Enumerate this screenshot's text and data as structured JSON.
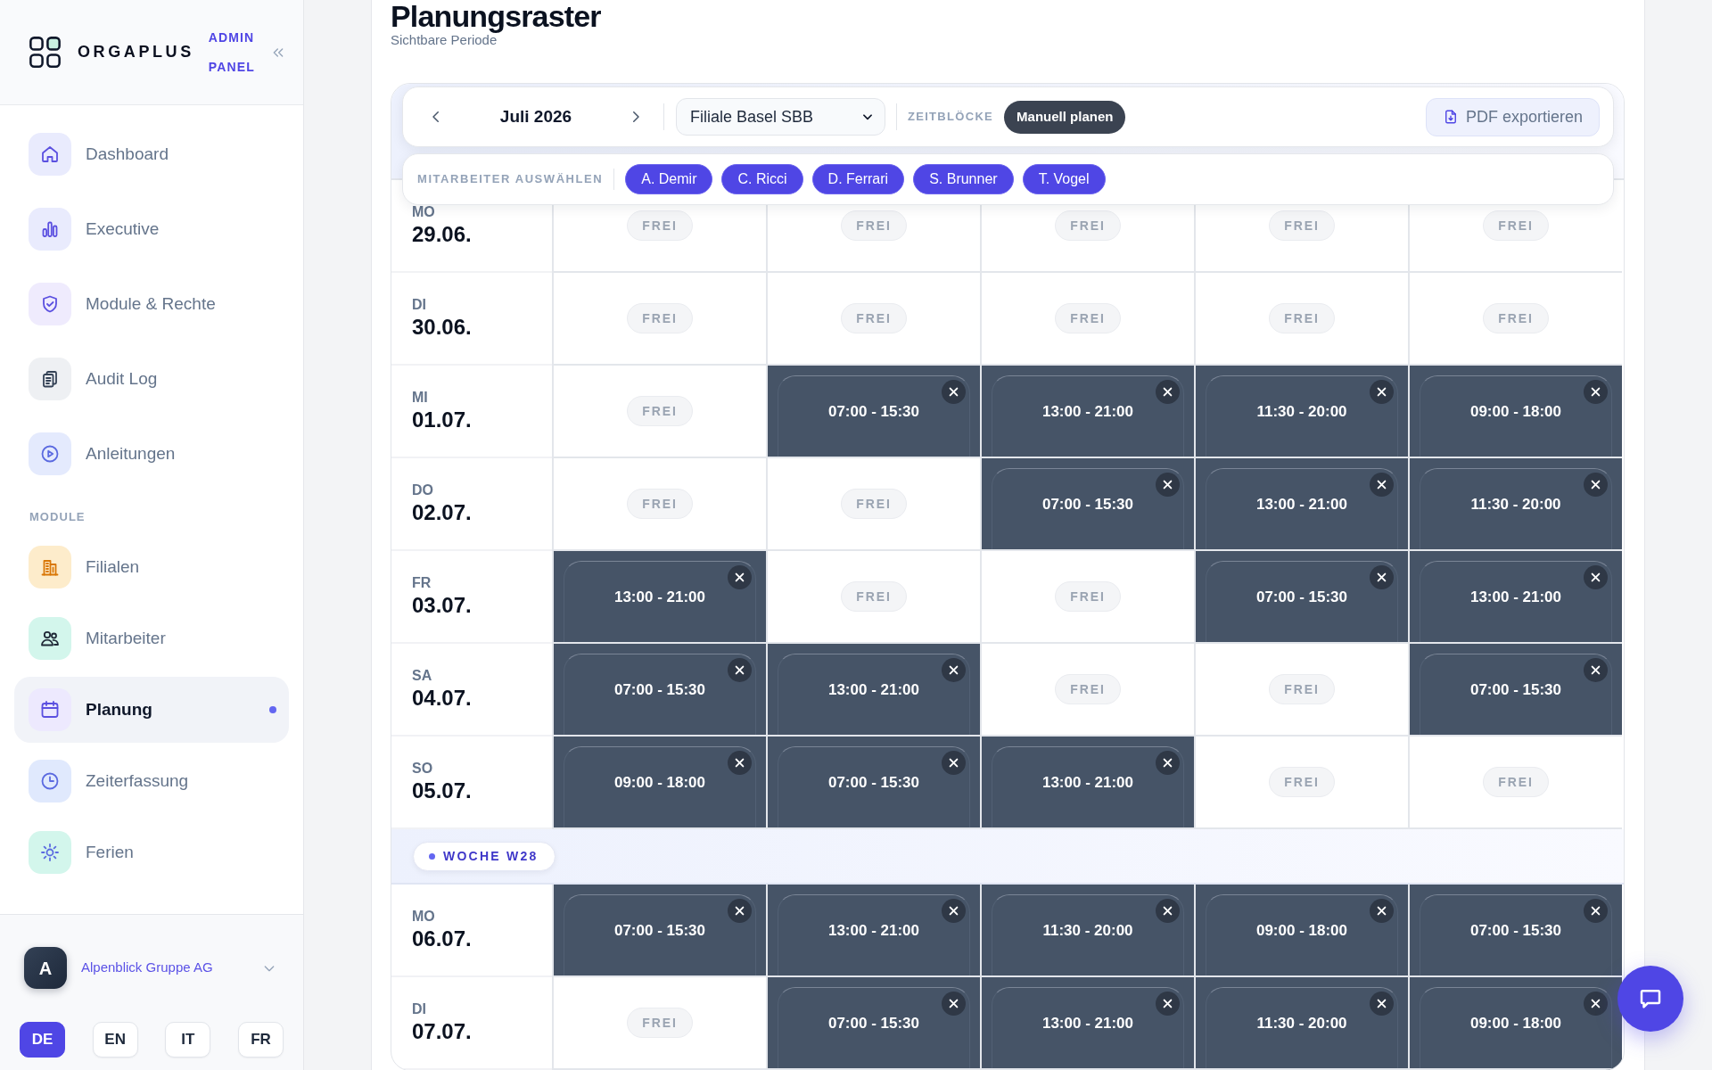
{
  "sidebar": {
    "brand": {
      "name": "ORGAPLUS",
      "subtitle": "ADMIN PANEL"
    },
    "items": [
      {
        "label": "Dashboard",
        "selected": false
      },
      {
        "label": "Executive",
        "selected": false
      },
      {
        "label": "Module & Rechte",
        "selected": false
      },
      {
        "label": "Audit Log",
        "selected": false
      },
      {
        "label": "Anleitungen",
        "selected": false
      }
    ],
    "section_label": "MODULE",
    "module_items": [
      {
        "label": "Filialen",
        "selected": false
      },
      {
        "label": "Mitarbeiter",
        "selected": false
      },
      {
        "label": "Planung",
        "selected": true
      },
      {
        "label": "Zeiterfassung",
        "selected": false
      },
      {
        "label": "Ferien",
        "selected": false
      }
    ],
    "organization": {
      "initial": "A",
      "name": "Alpenblick Gruppe AG"
    },
    "languages": [
      {
        "label": "DE",
        "selected": true
      },
      {
        "label": "EN",
        "selected": false
      },
      {
        "label": "IT",
        "selected": false
      },
      {
        "label": "FR",
        "selected": false
      }
    ]
  },
  "page": {
    "title": "Planungsraster",
    "subtitle": "Sichtbare Periode"
  },
  "toolbar": {
    "month": "Juli 2026",
    "branch": "Filiale Basel SBB",
    "blocks_label": "ZEITBLÖCKE",
    "mode_button": "Manuell planen",
    "export_button": "PDF exportieren"
  },
  "employee_picker": {
    "label": "MITARBEITER AUSWÄHLEN",
    "employees": [
      {
        "name": "A. Demir",
        "selected": true
      },
      {
        "name": "C. Ricci",
        "selected": true
      },
      {
        "name": "D. Ferrari",
        "selected": true
      },
      {
        "name": "S. Brunner",
        "selected": true
      },
      {
        "name": "T. Vogel",
        "selected": true
      }
    ]
  },
  "schedule": {
    "rows": [
      {
        "kind": "day",
        "weekday": "MO",
        "date": "29.06.",
        "cells": [
          {
            "kind": "free",
            "label": "FREI"
          },
          {
            "kind": "free",
            "label": "FREI"
          },
          {
            "kind": "free",
            "label": "FREI"
          },
          {
            "kind": "free",
            "label": "FREI"
          },
          {
            "kind": "free",
            "label": "FREI"
          }
        ]
      },
      {
        "kind": "day",
        "weekday": "DI",
        "date": "30.06.",
        "cells": [
          {
            "kind": "free",
            "label": "FREI"
          },
          {
            "kind": "free",
            "label": "FREI"
          },
          {
            "kind": "free",
            "label": "FREI"
          },
          {
            "kind": "free",
            "label": "FREI"
          },
          {
            "kind": "free",
            "label": "FREI"
          }
        ]
      },
      {
        "kind": "day",
        "weekday": "MI",
        "date": "01.07.",
        "cells": [
          {
            "kind": "free",
            "label": "FREI"
          },
          {
            "kind": "shift",
            "time": "07:00 - 15:30"
          },
          {
            "kind": "shift",
            "time": "13:00 - 21:00"
          },
          {
            "kind": "shift",
            "time": "11:30 - 20:00"
          },
          {
            "kind": "shift",
            "time": "09:00 - 18:00"
          }
        ]
      },
      {
        "kind": "day",
        "weekday": "DO",
        "date": "02.07.",
        "cells": [
          {
            "kind": "free",
            "label": "FREI"
          },
          {
            "kind": "free",
            "label": "FREI"
          },
          {
            "kind": "shift",
            "time": "07:00 - 15:30"
          },
          {
            "kind": "shift",
            "time": "13:00 - 21:00"
          },
          {
            "kind": "shift",
            "time": "11:30 - 20:00"
          }
        ]
      },
      {
        "kind": "day",
        "weekday": "FR",
        "date": "03.07.",
        "cells": [
          {
            "kind": "shift",
            "time": "13:00 - 21:00"
          },
          {
            "kind": "free",
            "label": "FREI"
          },
          {
            "kind": "free",
            "label": "FREI"
          },
          {
            "kind": "shift",
            "time": "07:00 - 15:30"
          },
          {
            "kind": "shift",
            "time": "13:00 - 21:00"
          }
        ]
      },
      {
        "kind": "day",
        "weekday": "SA",
        "date": "04.07.",
        "cells": [
          {
            "kind": "shift",
            "time": "07:00 - 15:30"
          },
          {
            "kind": "shift",
            "time": "13:00 - 21:00"
          },
          {
            "kind": "free",
            "label": "FREI"
          },
          {
            "kind": "free",
            "label": "FREI"
          },
          {
            "kind": "shift",
            "time": "07:00 - 15:30"
          }
        ]
      },
      {
        "kind": "day",
        "weekday": "SO",
        "date": "05.07.",
        "cells": [
          {
            "kind": "shift",
            "time": "09:00 - 18:00"
          },
          {
            "kind": "shift",
            "time": "07:00 - 15:30"
          },
          {
            "kind": "shift",
            "time": "13:00 - 21:00"
          },
          {
            "kind": "free",
            "label": "FREI"
          },
          {
            "kind": "free",
            "label": "FREI"
          }
        ]
      },
      {
        "kind": "week",
        "label": "WOCHE W28"
      },
      {
        "kind": "day",
        "weekday": "MO",
        "date": "06.07.",
        "cells": [
          {
            "kind": "shift",
            "time": "07:00 - 15:30"
          },
          {
            "kind": "shift",
            "time": "13:00 - 21:00"
          },
          {
            "kind": "shift",
            "time": "11:30 - 20:00"
          },
          {
            "kind": "shift",
            "time": "09:00 - 18:00"
          },
          {
            "kind": "shift",
            "time": "07:00 - 15:30"
          }
        ]
      },
      {
        "kind": "day",
        "weekday": "DI",
        "date": "07.07.",
        "cells": [
          {
            "kind": "free",
            "label": "FREI"
          },
          {
            "kind": "shift",
            "time": "07:00 - 15:30"
          },
          {
            "kind": "shift",
            "time": "13:00 - 21:00"
          },
          {
            "kind": "shift",
            "time": "11:30 - 20:00"
          },
          {
            "kind": "shift",
            "time": "09:00 - 18:00"
          }
        ]
      }
    ]
  }
}
